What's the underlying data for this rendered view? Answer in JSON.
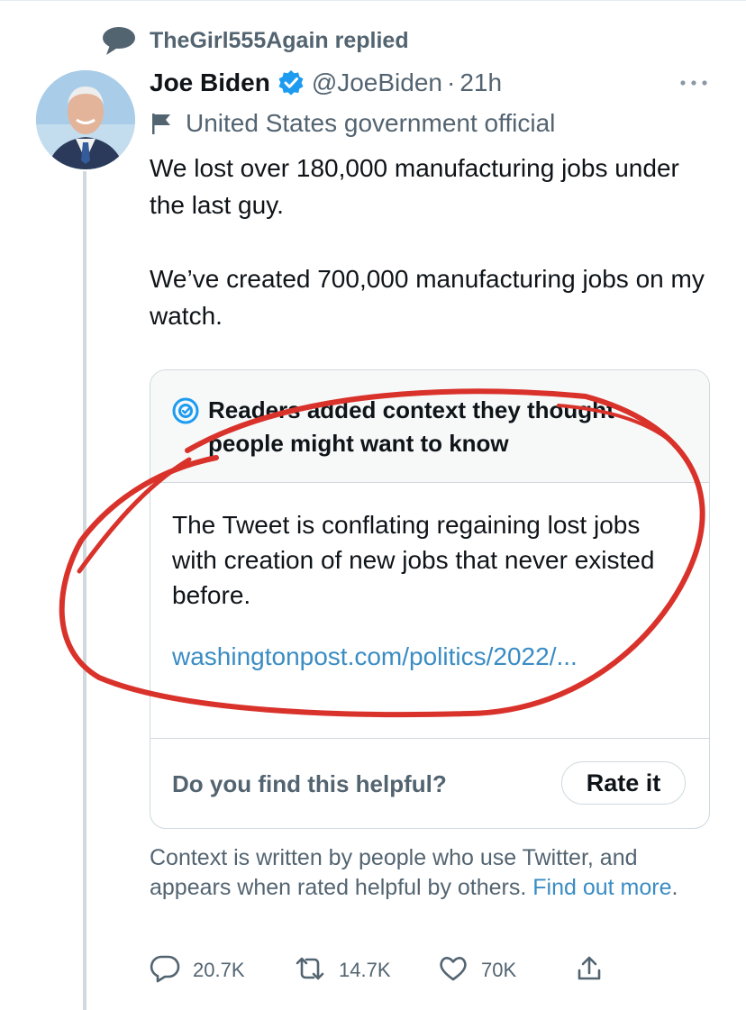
{
  "social_context": {
    "text": "TheGirl555Again replied"
  },
  "tweet": {
    "display_name": "Joe Biden",
    "handle": "@JoeBiden",
    "separator": "·",
    "time": "21h",
    "label": "United States government official",
    "text_paragraph_1": "We lost over 180,000 manufacturing jobs under the last guy.",
    "text_paragraph_2": "We’ve created 700,000 manufacturing jobs on my watch."
  },
  "community_note": {
    "header": "Readers added context they thought people might want to know",
    "body": "The Tweet is conflating regaining lost jobs with creation of new jobs that never existed before.",
    "link": "washingtonpost.com/politics/2022/...",
    "question": "Do you find this helpful?",
    "rate_button": "Rate it"
  },
  "context_footer": {
    "text": "Context is written by people who use Twitter, and appears when rated helpful by others.",
    "link": "Find out more",
    "period": "."
  },
  "actions": {
    "replies": "20.7K",
    "retweets": "14.7K",
    "likes": "70K"
  },
  "icons": {
    "reply": "speech-bubble-icon",
    "verified": "verified-badge-icon",
    "label": "flag-icon",
    "note": "community-notes-icon",
    "retweet": "retweet-icon",
    "like": "heart-icon",
    "share": "share-icon",
    "more": "more-icon"
  },
  "colors": {
    "verified": "#1d9bf0",
    "link": "#3a8cc4",
    "secondary_text": "#536471",
    "annotation_marker": "#d9322b"
  }
}
